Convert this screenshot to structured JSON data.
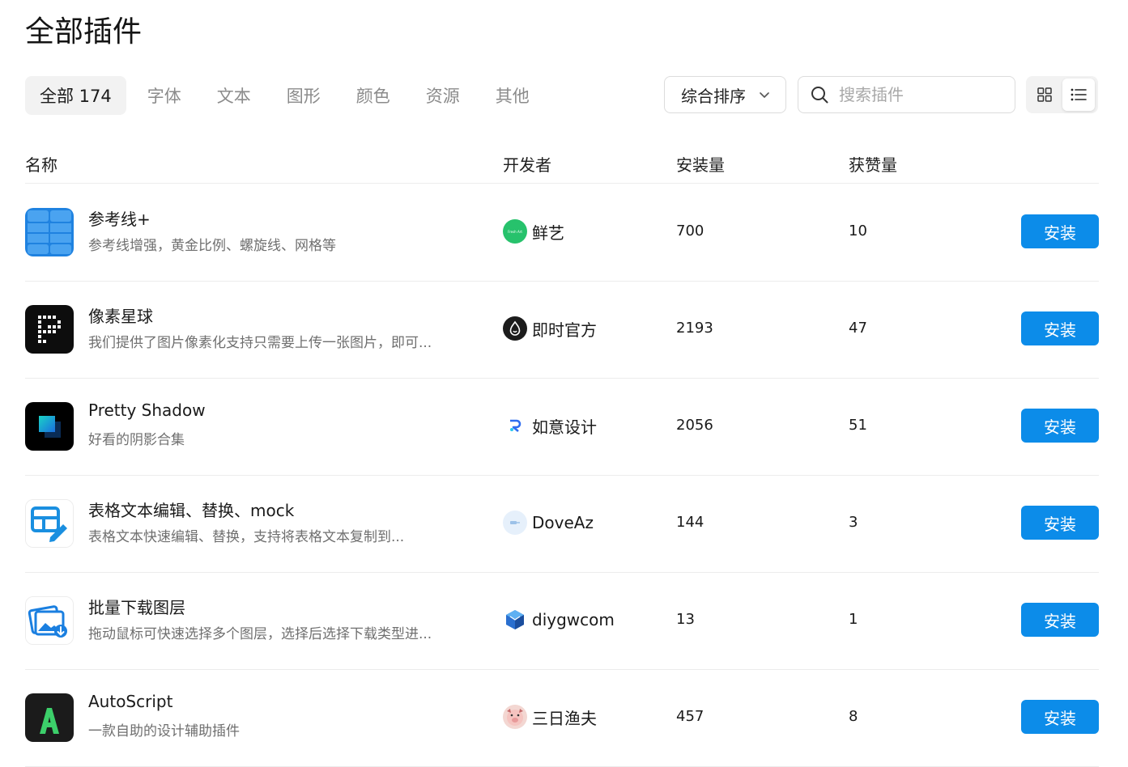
{
  "page_title": "全部插件",
  "filters": [
    {
      "label": "全部 174",
      "active": true
    },
    {
      "label": "字体",
      "active": false
    },
    {
      "label": "文本",
      "active": false
    },
    {
      "label": "图形",
      "active": false
    },
    {
      "label": "颜色",
      "active": false
    },
    {
      "label": "资源",
      "active": false
    },
    {
      "label": "其他",
      "active": false
    }
  ],
  "sort": {
    "value": "综合排序",
    "icon": "chevron-down-icon"
  },
  "search": {
    "placeholder": "搜索插件",
    "value": "",
    "icon": "search-icon"
  },
  "view_toggle": {
    "options": [
      "grid-view-icon",
      "list-view-icon"
    ],
    "selected": "list-view-icon"
  },
  "table": {
    "columns": [
      "名称",
      "开发者",
      "安装量",
      "获赞量"
    ],
    "rows": [
      {
        "icon": "grid-lines-icon",
        "name": "参考线+",
        "desc": "参考线增强，黄金比例、螺旋线、网格等",
        "developer": "鲜艺",
        "dev_avatar_text": "Fresh Art",
        "installs": "700",
        "likes": "10",
        "action": "安装"
      },
      {
        "icon": "pixel-p-icon",
        "name": "像素星球",
        "desc": "我们提供了图片像素化支持只需要上传一张图片，即可...",
        "developer": "即时官方",
        "installs": "2193",
        "likes": "47",
        "action": "安装"
      },
      {
        "icon": "shadow-square-icon",
        "name": "Pretty Shadow",
        "desc": "好看的阴影合集",
        "developer": "如意设计",
        "installs": "2056",
        "likes": "51",
        "action": "安装"
      },
      {
        "icon": "table-edit-icon",
        "name": "表格文本编辑、替换、mock",
        "desc": "表格文本快速编辑、替换，支持将表格文本复制到...",
        "developer": "DoveAz",
        "installs": "144",
        "likes": "3",
        "action": "安装"
      },
      {
        "icon": "image-download-icon",
        "name": "批量下载图层",
        "desc": "拖动鼠标可快速选择多个图层，选择后选择下载类型进...",
        "developer": "diygwcom",
        "installs": "13",
        "likes": "1",
        "action": "安装"
      },
      {
        "icon": "letter-a-icon",
        "name": "AutoScript",
        "desc": "一款自助的设计辅助插件",
        "developer": "三日渔夫",
        "installs": "457",
        "likes": "8",
        "action": "安装"
      }
    ]
  },
  "colors": {
    "accent": "#0c8ce9",
    "chip_active_bg": "#f2f2f2",
    "divider": "#ececec"
  }
}
